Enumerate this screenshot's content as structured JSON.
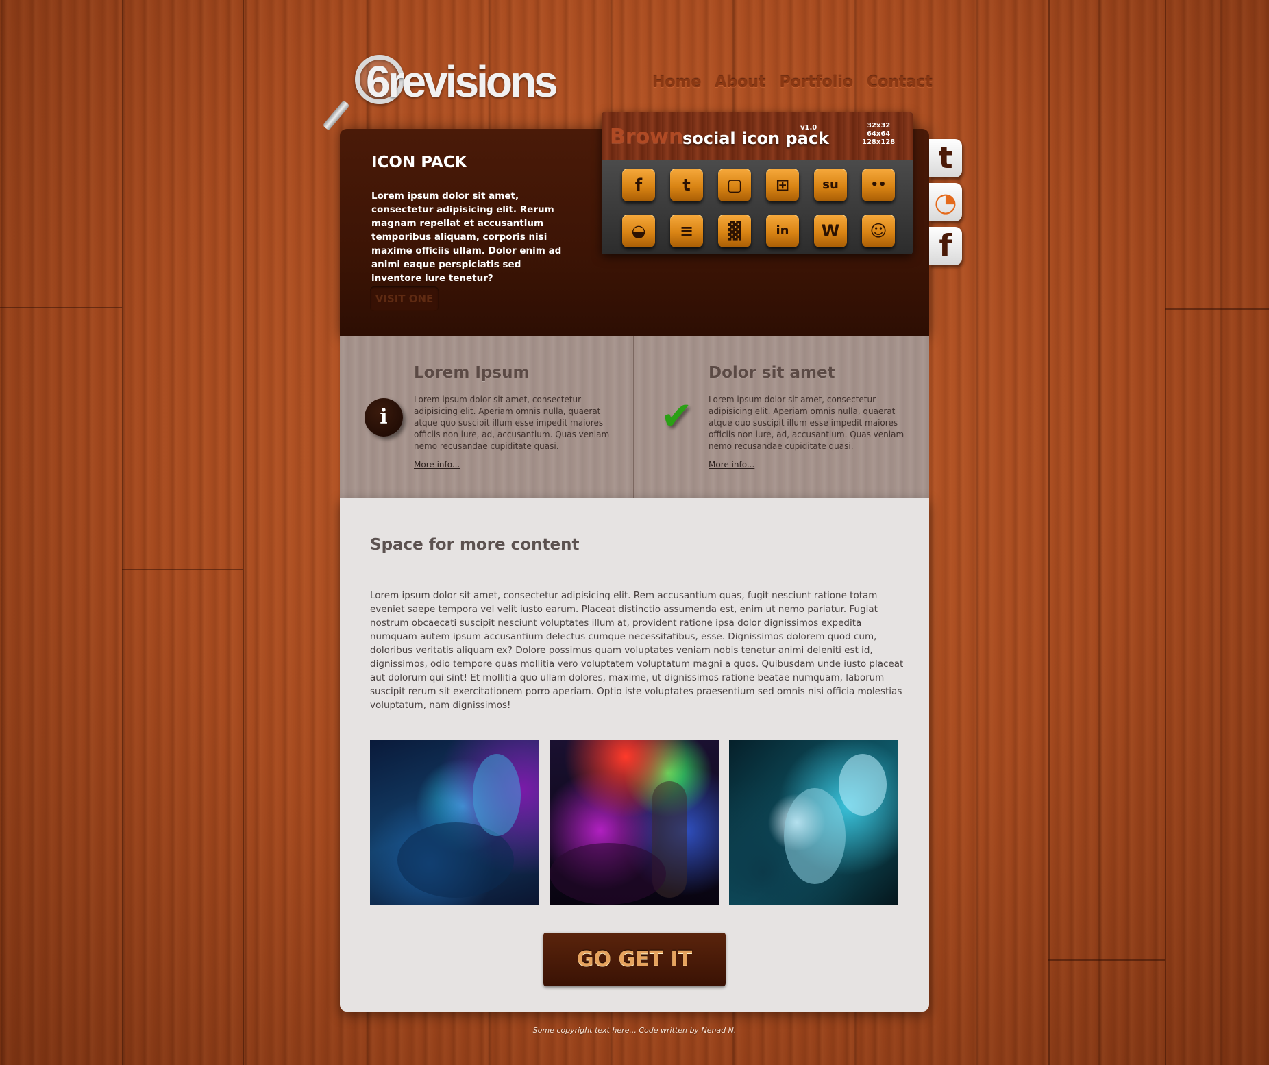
{
  "header": {
    "logo_text": "6revisions",
    "nav": [
      "Home",
      "About",
      "Portfolio",
      "Contact"
    ]
  },
  "hero": {
    "title": "ICON PACK",
    "text": "Lorem ipsum dolor sit amet, consectetur adipisicing elit. Rerum magnam repellat et accusantium temporibus aliquam, corporis nisi maxime officiis ullam. Dolor enim ad animi eaque perspiciatis sed inventore iure tenetur?",
    "button_label": "VISIT ONE"
  },
  "icon_pack": {
    "brand_word": "Brown",
    "title": "social icon pack",
    "version": "v1.0",
    "sizes": [
      "32x32",
      "64x64",
      "128x128"
    ],
    "icons": [
      "facebook-icon",
      "twitter-icon",
      "blogger-icon",
      "windows-icon",
      "stumbleupon-icon",
      "flickr-icon",
      "delicious-icon",
      "rss-icon",
      "myspace-icon",
      "linkedin-icon",
      "wordpress-icon",
      "reddit-icon"
    ],
    "glyphs": [
      "f",
      "t",
      "▢",
      "⊞",
      "su",
      "••",
      "◒",
      "≡",
      "▓",
      "in",
      "W",
      "☺"
    ]
  },
  "social": {
    "items": [
      {
        "name": "twitter-icon",
        "glyph": "t"
      },
      {
        "name": "rss-icon",
        "glyph": "◔"
      },
      {
        "name": "facebook-icon",
        "glyph": "f"
      }
    ]
  },
  "features": [
    {
      "icon": "info-icon",
      "icon_glyph": "i",
      "title": "Lorem Ipsum",
      "text": "Lorem ipsum dolor sit amet, consectetur adipisicing elit. Aperiam omnis nulla, quaerat atque quo suscipit illum esse impedit maiores officiis non iure, ad, accusantium. Quas veniam nemo recusandae cupiditate quasi.",
      "more": "More info..."
    },
    {
      "icon": "checkmark-icon",
      "icon_glyph": "✔",
      "title": "Dolor sit amet",
      "text": "Lorem ipsum dolor sit amet, consectetur adipisicing elit. Aperiam omnis nulla, quaerat atque quo suscipit illum esse impedit maiores officiis non iure, ad, accusantium. Quas veniam nemo recusandae cupiditate quasi.",
      "more": "More info..."
    }
  ],
  "content": {
    "title": "Space for more content",
    "text": "Lorem ipsum dolor sit amet, consectetur adipisicing elit. Rem accusantium quas, fugit nesciunt ratione totam eveniet saepe tempora vel velit iusto earum. Placeat distinctio assumenda est, enim ut nemo pariatur. Fugiat nostrum obcaecati suscipit nesciunt voluptates illum at, provident ratione ipsa dolor dignissimos expedita numquam autem ipsum accusantium delectus cumque necessitatibus, esse. Dignissimos dolorem quod cum, doloribus veritatis aliquam ex? Dolore possimus quam voluptates veniam nobis tenetur animi deleniti est id, dignissimos, odio tempore quas mollitia vero voluptatem voluptatum magni a quos. Quibusdam unde iusto placeat aut dolorum qui sint! Et mollitia quo ullam dolores, maxime, ut dignissimos ratione beatae numquam, laborum suscipit rerum sit exercitationem porro aperiam. Optio iste voluptates praesentium sed omnis nisi officia molestias voluptatum, nam dignissimos!",
    "button_label": "GO GET IT"
  },
  "footer": {
    "text": "Some copyright text here... Code written by Nenad N."
  },
  "colors": {
    "wood": "#a64a1f",
    "hero_bg": "#3c1405",
    "features_bg": "#a4918a",
    "content_bg": "#e6e3e2",
    "accent_orange": "#d98414",
    "check_green": "#2aa015"
  }
}
